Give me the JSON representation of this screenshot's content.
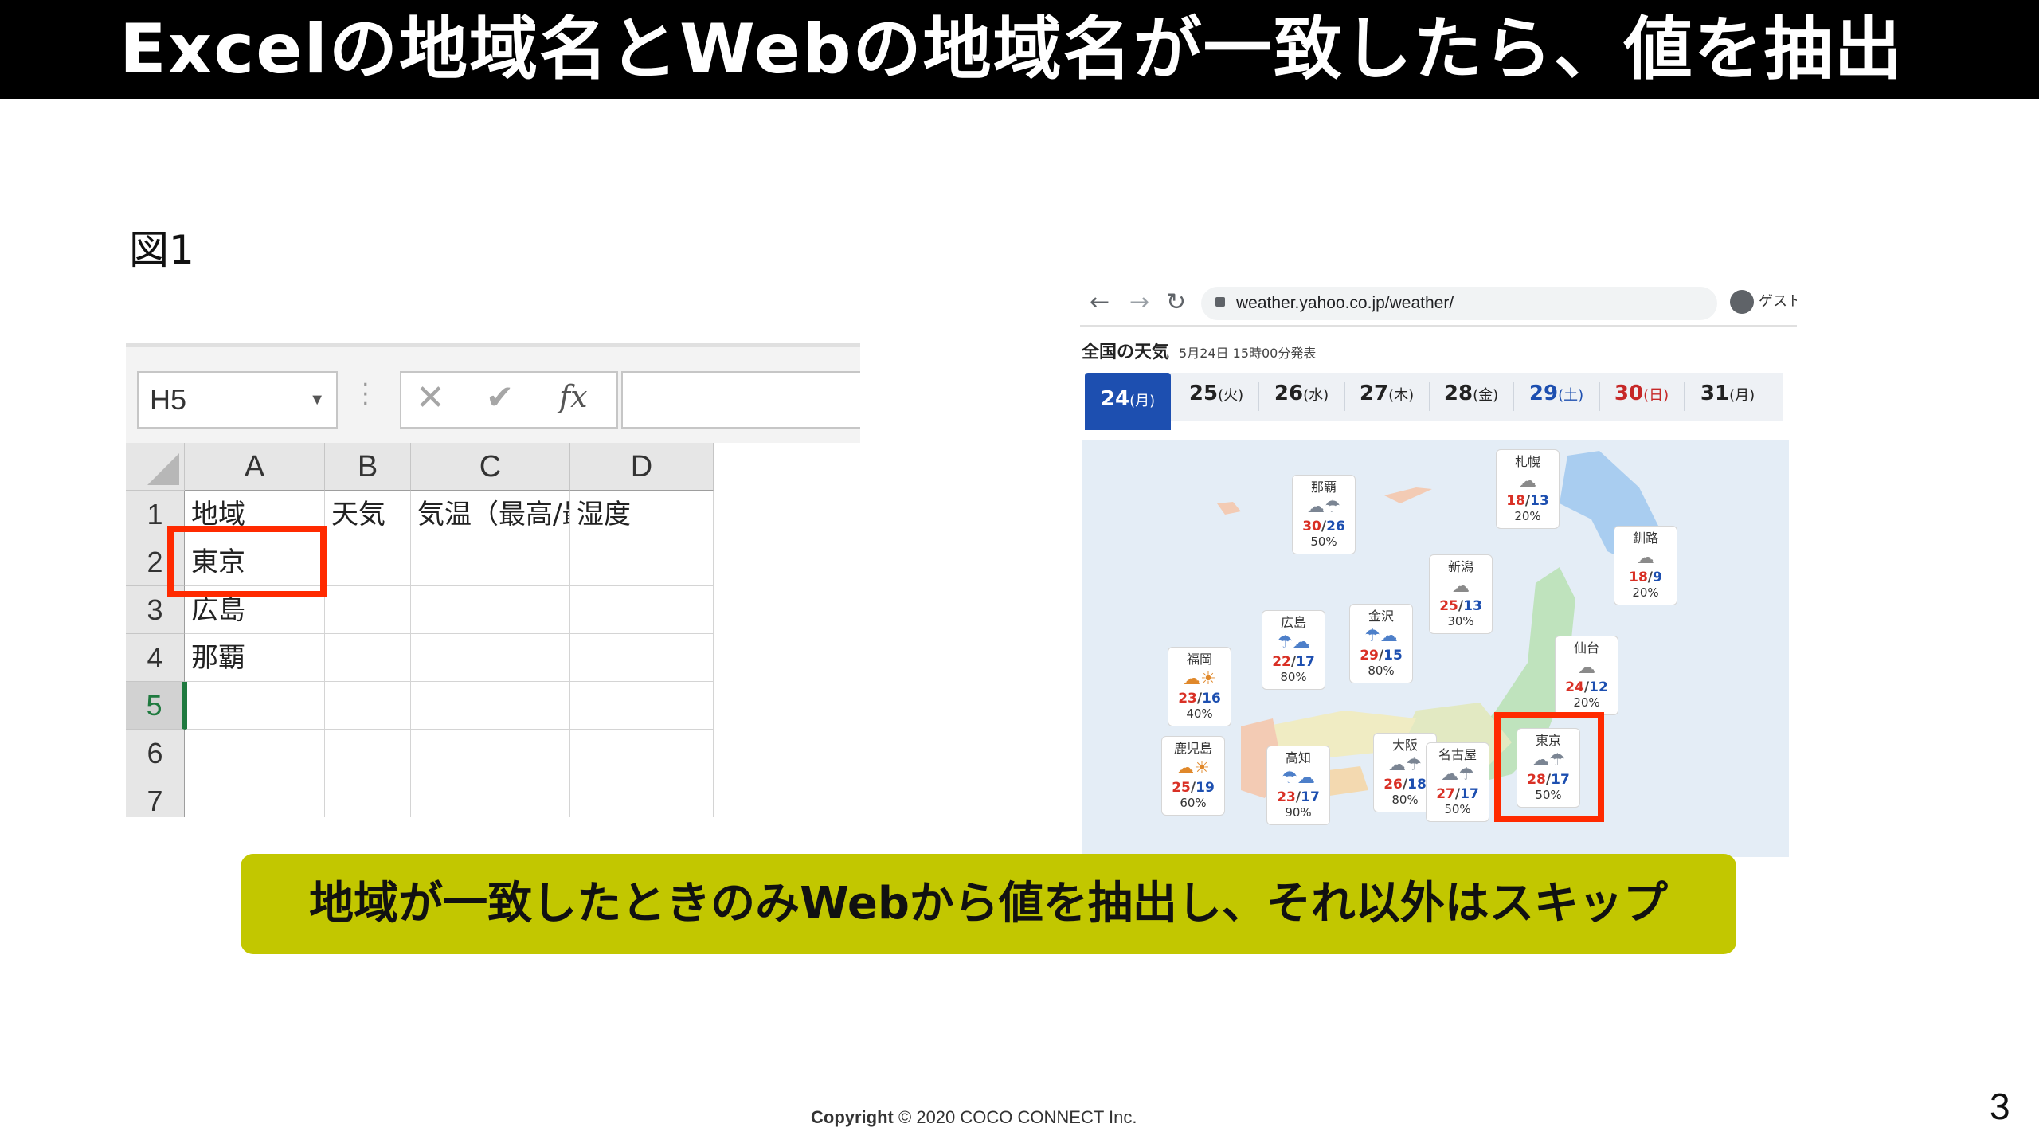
{
  "slide": {
    "title": "Excelの地域名とWebの地域名が一致したら、値を抽出",
    "figure_label": "図1",
    "callout": "地域が一致したときのみWebから値を抽出し、それ以外はスキップ",
    "copyright_label": "Copyright",
    "copyright_text": "© 2020 COCO CONNECT Inc.",
    "page_number": "3"
  },
  "excel": {
    "name_box": "H5",
    "fx_symbol": "fx",
    "columns": [
      "A",
      "B",
      "C",
      "D"
    ],
    "rows": [
      {
        "num": "1",
        "cells": [
          "地域",
          "天気",
          "気温（最高/最低）",
          "湿度"
        ]
      },
      {
        "num": "2",
        "cells": [
          "東京",
          "",
          "",
          ""
        ]
      },
      {
        "num": "3",
        "cells": [
          "広島",
          "",
          "",
          ""
        ]
      },
      {
        "num": "4",
        "cells": [
          "那覇",
          "",
          "",
          ""
        ]
      },
      {
        "num": "5",
        "cells": [
          "",
          "",
          "",
          ""
        ]
      },
      {
        "num": "6",
        "cells": [
          "",
          "",
          "",
          ""
        ]
      },
      {
        "num": "7",
        "cells": [
          "",
          "",
          "",
          ""
        ]
      }
    ],
    "active_row": "5",
    "highlight_color": "#ff2a00"
  },
  "browser": {
    "url": "weather.yahoo.co.jp/weather/",
    "profile": "ゲスト"
  },
  "weather": {
    "heading": "全国の天気",
    "published": "5月24日 15時00分発表",
    "dates": [
      {
        "day": "24",
        "dow": "(月)",
        "color": "#ffffff",
        "active": true
      },
      {
        "day": "25",
        "dow": "(火)",
        "color": "#222222"
      },
      {
        "day": "26",
        "dow": "(水)",
        "color": "#222222"
      },
      {
        "day": "27",
        "dow": "(木)",
        "color": "#222222"
      },
      {
        "day": "28",
        "dow": "(金)",
        "color": "#222222"
      },
      {
        "day": "29",
        "dow": "(土)",
        "color": "#1d4fb0"
      },
      {
        "day": "30",
        "dow": "(日)",
        "color": "#c62828"
      },
      {
        "day": "31",
        "dow": "(月)",
        "color": "#222222"
      }
    ],
    "cities": [
      {
        "name": "那覇",
        "icon": "cloud-rain-icon",
        "hi": "30",
        "lo": "26",
        "rain": "50%"
      },
      {
        "name": "札幌",
        "icon": "cloud-icon",
        "hi": "18",
        "lo": "13",
        "rain": "20%"
      },
      {
        "name": "釧路",
        "icon": "cloud-icon",
        "hi": "18",
        "lo": "9",
        "rain": "20%"
      },
      {
        "name": "新潟",
        "icon": "cloud-icon",
        "hi": "25",
        "lo": "13",
        "rain": "30%"
      },
      {
        "name": "金沢",
        "icon": "rain-cloud-icon",
        "hi": "29",
        "lo": "15",
        "rain": "80%"
      },
      {
        "name": "広島",
        "icon": "rain-cloud-icon",
        "hi": "22",
        "lo": "17",
        "rain": "80%"
      },
      {
        "name": "仙台",
        "icon": "cloud-icon",
        "hi": "24",
        "lo": "12",
        "rain": "20%"
      },
      {
        "name": "福岡",
        "icon": "cloud-sun-icon",
        "hi": "23",
        "lo": "16",
        "rain": "40%"
      },
      {
        "name": "東京",
        "icon": "cloud-rain-icon",
        "hi": "28",
        "lo": "17",
        "rain": "50%"
      },
      {
        "name": "鹿児島",
        "icon": "cloud-sun-icon",
        "hi": "25",
        "lo": "19",
        "rain": "60%"
      },
      {
        "name": "高知",
        "icon": "rain-cloud-icon",
        "hi": "23",
        "lo": "17",
        "rain": "90%"
      },
      {
        "name": "大阪",
        "icon": "cloud-rain-icon",
        "hi": "26",
        "lo": "18",
        "rain": "80%"
      },
      {
        "name": "名古屋",
        "icon": "cloud-rain-icon",
        "hi": "27",
        "lo": "17",
        "rain": "50%"
      }
    ]
  },
  "colors": {
    "title_bg": "#000000",
    "callout_bg": "#c2c700",
    "highlight": "#ff2a00",
    "active_tab": "#1d4fb0",
    "temp_high": "#d93025",
    "temp_low": "#1d4fb0"
  }
}
